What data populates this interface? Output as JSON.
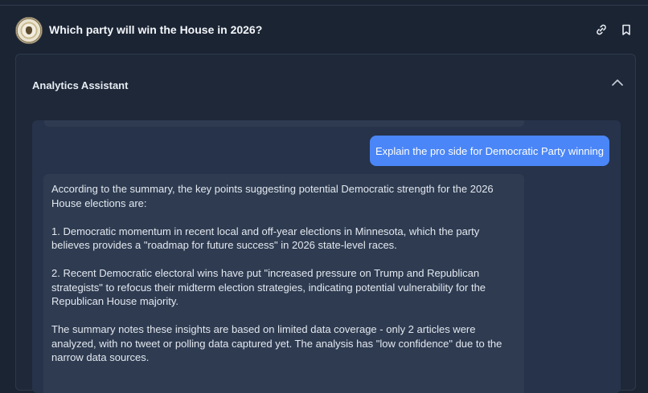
{
  "header": {
    "title": "Which party will win the House in 2026?"
  },
  "panel": {
    "title": "Analytics Assistant"
  },
  "chat": {
    "user_message": "Explain the pro side for Democratic Party winning",
    "assistant_paragraphs": [
      "According to the summary, the key points suggesting potential Democratic strength for the 2026 House elections are:",
      "1. Democratic momentum in recent local and off-year elections in Minnesota, which the party believes provides a \"roadmap for future success\" in 2026 state-level races.",
      "2. Recent Democratic electoral wins have put \"increased pressure on Trump and Republican strategists\" to refocus their midterm election strategies, indicating potential vulnerability for the Republican House majority.",
      "The summary notes these insights are based on limited data coverage - only 2 articles were analyzed, with no tweet or polling data captured yet. The analysis has \"low confidence\" due to the narrow data sources."
    ]
  },
  "colors": {
    "background": "#1b2433",
    "panel": "#1e2838",
    "chat_area": "#27334a",
    "assistant_bubble": "#2e3b51",
    "user_bubble": "#4a86f7"
  },
  "icons": {
    "logo": "house-seal-icon",
    "share": "link-icon",
    "save": "bookmark-icon",
    "collapse": "chevron-up-icon"
  }
}
